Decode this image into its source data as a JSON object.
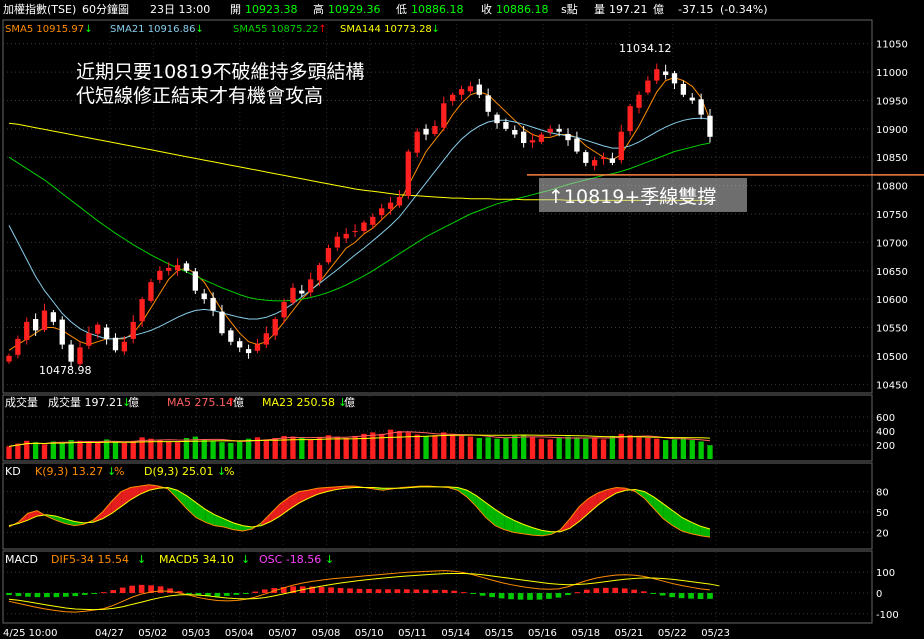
{
  "header": {
    "name": "加權指數(TSE)",
    "interval": "60分鐘圖",
    "datetime": "23日 13:00",
    "open_label": "開",
    "open": "10923.38",
    "high_label": "高",
    "high": "10929.36",
    "low_label": "低",
    "low": "10886.18",
    "close_label": "收",
    "close": "10886.18",
    "unit": "s點",
    "vol_label": "量",
    "vol": "197.21",
    "vol_unit": "億",
    "change": "-37.15",
    "change_pct": "(-0.34%)"
  },
  "price_legend": [
    {
      "text": "SMA5 10915.97",
      "arrow": "↓",
      "color": "#ff8c00",
      "arrow_color": "#00ff00"
    },
    {
      "text": "SMA21 10916.86",
      "arrow": "↓",
      "color": "#87ceeb",
      "arrow_color": "#00ff00"
    },
    {
      "text": "SMA55 10875.22",
      "arrow": "↑",
      "color": "#00d000",
      "arrow_color": "#ff0000"
    },
    {
      "text": "SMA144 10773.28",
      "arrow": "↓",
      "color": "#ffff00",
      "arrow_color": "#00ff00"
    }
  ],
  "annotations": {
    "line1": "近期只要10819不破維持多頭結構",
    "line2": "代短線修正結束才有機會攻高",
    "support_box": "↑10819+季線雙撐",
    "high_label": "11034.12",
    "low_label": "10478.98"
  },
  "vol_legend": {
    "name": "成交量",
    "v1": "成交量  197.21",
    "v1_unit": "億",
    "ma5": "MA5  275.14",
    "ma5_unit": "億",
    "ma23": "MA23  250.58",
    "ma23_unit": "億"
  },
  "kd_legend": {
    "name": "KD",
    "k": "K(9,3) 13.27",
    "k_unit": "%",
    "d": "D(9,3) 25.01",
    "d_unit": "%"
  },
  "macd_legend": {
    "name": "MACD",
    "dif": "DIF5-34 15.54",
    "macd": "MACD5 34.10",
    "osc": "OSC -18.56"
  },
  "colors": {
    "up": "#ff2020",
    "down": "#ffffff",
    "up_vol": "#ff2020",
    "down_vol": "#00c800",
    "grid": "#3a3a3a",
    "axis": "#888888"
  },
  "chart_data": {
    "type": "candlestick",
    "x_tick_labels": [
      "4/25 10:00",
      "04/27",
      "05/02",
      "05/03",
      "05/04",
      "05/07",
      "05/08",
      "05/10",
      "05/11",
      "05/14",
      "05/15",
      "05/16",
      "05/18",
      "05/21",
      "05/22",
      "05/23"
    ],
    "price_ticks": [
      11050,
      11000,
      10950,
      10900,
      10850,
      10800,
      10750,
      10700,
      10650,
      10600,
      10550,
      10500,
      10450
    ],
    "price_ylim": [
      10440,
      11060
    ],
    "support_level": 10819,
    "volume_ticks": [
      600,
      400,
      200
    ],
    "volume_ylim": [
      0,
      700
    ],
    "kd_ticks": [
      80,
      50,
      20
    ],
    "macd_ticks": [
      100,
      0,
      -100
    ],
    "close": [
      10500,
      10530,
      10560,
      10545,
      10580,
      10560,
      10520,
      10490,
      10515,
      10540,
      10555,
      10530,
      10510,
      10525,
      10560,
      10600,
      10630,
      10650,
      10655,
      10660,
      10650,
      10615,
      10600,
      10580,
      10540,
      10525,
      10515,
      10505,
      10520,
      10540,
      10565,
      10595,
      10620,
      10610,
      10635,
      10660,
      10690,
      10710,
      10715,
      10720,
      10735,
      10745,
      10760,
      10770,
      10780,
      10860,
      10895,
      10890,
      10905,
      10945,
      10960,
      10970,
      10975,
      10960,
      10930,
      10910,
      10900,
      10890,
      10875,
      10880,
      10890,
      10900,
      10895,
      10880,
      10860,
      10840,
      10845,
      10850,
      10840,
      10895,
      10940,
      10960,
      10985,
      11005,
      10995,
      10980,
      10960,
      10950,
      10925,
      10886
    ],
    "sma5": [
      10510,
      10520,
      10530,
      10540,
      10550,
      10550,
      10545,
      10535,
      10525,
      10520,
      10525,
      10530,
      10530,
      10530,
      10540,
      10560,
      10585,
      10610,
      10635,
      10650,
      10655,
      10645,
      10630,
      10605,
      10580,
      10560,
      10540,
      10525,
      10520,
      10525,
      10540,
      10560,
      10580,
      10600,
      10615,
      10630,
      10650,
      10670,
      10690,
      10700,
      10715,
      10725,
      10740,
      10755,
      10770,
      10800,
      10830,
      10860,
      10880,
      10900,
      10925,
      10945,
      10960,
      10965,
      10960,
      10945,
      10930,
      10915,
      10900,
      10890,
      10885,
      10885,
      10890,
      10890,
      10885,
      10870,
      10860,
      10850,
      10845,
      10855,
      10880,
      10905,
      10935,
      10965,
      10985,
      10990,
      10985,
      10975,
      10955,
      10916
    ],
    "sma21": [
      10730,
      10700,
      10670,
      10640,
      10615,
      10595,
      10575,
      10560,
      10548,
      10540,
      10535,
      10530,
      10530,
      10532,
      10536,
      10540,
      10545,
      10552,
      10560,
      10568,
      10575,
      10580,
      10582,
      10580,
      10576,
      10572,
      10568,
      10565,
      10565,
      10568,
      10574,
      10582,
      10592,
      10604,
      10616,
      10628,
      10640,
      10652,
      10665,
      10678,
      10690,
      10703,
      10716,
      10730,
      10745,
      10765,
      10785,
      10805,
      10825,
      10845,
      10865,
      10882,
      10895,
      10905,
      10912,
      10915,
      10915,
      10912,
      10908,
      10903,
      10898,
      10893,
      10890,
      10888,
      10885,
      10880,
      10875,
      10870,
      10866,
      10866,
      10870,
      10877,
      10886,
      10895,
      10903,
      10910,
      10915,
      10918,
      10919,
      10917
    ],
    "sma55": [
      10850,
      10840,
      10830,
      10820,
      10810,
      10798,
      10786,
      10774,
      10762,
      10750,
      10738,
      10727,
      10716,
      10706,
      10696,
      10687,
      10678,
      10670,
      10662,
      10655,
      10648,
      10641,
      10634,
      10627,
      10620,
      10614,
      10608,
      10603,
      10600,
      10598,
      10597,
      10597,
      10598,
      10600,
      10603,
      10607,
      10612,
      10618,
      10625,
      10633,
      10641,
      10650,
      10660,
      10670,
      10680,
      10690,
      10700,
      10710,
      10718,
      10726,
      10734,
      10742,
      10750,
      10756,
      10762,
      10768,
      10772,
      10776,
      10780,
      10784,
      10788,
      10792,
      10797,
      10802,
      10806,
      10810,
      10814,
      10818,
      10821,
      10825,
      10830,
      10836,
      10842,
      10848,
      10854,
      10860,
      10864,
      10868,
      10872,
      10875
    ],
    "sma144": [
      10910,
      10908,
      10905,
      10902,
      10899,
      10896,
      10893,
      10890,
      10887,
      10884,
      10881,
      10878,
      10875,
      10872,
      10869,
      10866,
      10863,
      10860,
      10857,
      10854,
      10851,
      10848,
      10845,
      10842,
      10839,
      10836,
      10833,
      10830,
      10827,
      10824,
      10821,
      10818,
      10815,
      10812,
      10809,
      10806,
      10803,
      10800,
      10797,
      10794,
      10792,
      10790,
      10788,
      10786,
      10784,
      10783,
      10782,
      10781,
      10780,
      10779,
      10778,
      10778,
      10777,
      10777,
      10777,
      10776,
      10776,
      10776,
      10775,
      10775,
      10775,
      10775,
      10775,
      10774,
      10774,
      10774,
      10774,
      10774,
      10774,
      10774,
      10774,
      10774,
      10774,
      10774,
      10774,
      10774,
      10774,
      10774,
      10774,
      10773
    ],
    "volume": [
      180,
      220,
      260,
      240,
      210,
      250,
      230,
      270,
      260,
      240,
      230,
      280,
      250,
      230,
      260,
      310,
      290,
      270,
      250,
      240,
      300,
      320,
      280,
      260,
      240,
      230,
      250,
      290,
      310,
      280,
      300,
      330,
      320,
      300,
      280,
      310,
      340,
      320,
      300,
      330,
      360,
      380,
      360,
      420,
      400,
      380,
      350,
      330,
      340,
      380,
      360,
      330,
      320,
      300,
      310,
      290,
      300,
      330,
      350,
      310,
      290,
      280,
      300,
      320,
      310,
      290,
      300,
      280,
      330,
      360,
      340,
      310,
      300,
      290,
      270,
      280,
      300,
      270,
      250,
      197
    ],
    "k": [
      28,
      35,
      48,
      52,
      44,
      38,
      33,
      30,
      32,
      38,
      50,
      66,
      80,
      86,
      88,
      90,
      88,
      84,
      70,
      55,
      42,
      35,
      30,
      28,
      24,
      22,
      25,
      34,
      48,
      62,
      72,
      80,
      82,
      85,
      86,
      87,
      88,
      88,
      86,
      84,
      82,
      84,
      86,
      87,
      88,
      88,
      87,
      86,
      82,
      72,
      58,
      42,
      30,
      24,
      20,
      18,
      16,
      15,
      17,
      24,
      40,
      58,
      70,
      78,
      83,
      86,
      85,
      80,
      70,
      55,
      40,
      30,
      22,
      18,
      15,
      13
    ],
    "d": [
      30,
      33,
      38,
      44,
      46,
      44,
      40,
      36,
      34,
      35,
      40,
      48,
      58,
      68,
      76,
      82,
      85,
      86,
      82,
      74,
      64,
      54,
      46,
      40,
      34,
      30,
      28,
      30,
      36,
      44,
      54,
      63,
      70,
      76,
      80,
      83,
      85,
      86,
      86,
      86,
      85,
      85,
      85,
      86,
      87,
      87,
      87,
      87,
      86,
      82,
      74,
      64,
      54,
      45,
      38,
      32,
      27,
      23,
      21,
      21,
      26,
      36,
      48,
      60,
      70,
      78,
      82,
      83,
      80,
      72,
      62,
      52,
      42,
      35,
      29,
      25
    ],
    "dif": [
      -40,
      -50,
      -60,
      -70,
      -78,
      -85,
      -90,
      -92,
      -88,
      -82,
      -75,
      -60,
      -40,
      -20,
      -5,
      5,
      10,
      8,
      0,
      -10,
      -22,
      -30,
      -36,
      -38,
      -36,
      -30,
      -20,
      -5,
      10,
      25,
      38,
      48,
      56,
      62,
      68,
      72,
      76,
      80,
      84,
      88,
      92,
      96,
      100,
      102,
      104,
      106,
      108,
      105,
      98,
      88,
      75,
      62,
      50,
      40,
      32,
      25,
      20,
      18,
      20,
      30,
      45,
      60,
      72,
      80,
      86,
      88,
      86,
      80,
      70,
      58,
      46,
      36,
      28,
      20,
      15
    ],
    "macd": [
      -30,
      -35,
      -42,
      -50,
      -58,
      -65,
      -72,
      -77,
      -79,
      -80,
      -79,
      -74,
      -66,
      -55,
      -44,
      -32,
      -22,
      -14,
      -9,
      -8,
      -10,
      -14,
      -19,
      -24,
      -27,
      -28,
      -27,
      -22,
      -14,
      -4,
      6,
      16,
      25,
      33,
      41,
      48,
      54,
      60,
      65,
      70,
      74,
      78,
      82,
      85,
      88,
      91,
      93,
      94,
      94,
      92,
      88,
      82,
      76,
      70,
      64,
      58,
      52,
      46,
      42,
      40,
      41,
      44,
      49,
      55,
      61,
      66,
      70,
      72,
      72,
      70,
      66,
      61,
      55,
      49,
      43,
      34
    ]
  }
}
